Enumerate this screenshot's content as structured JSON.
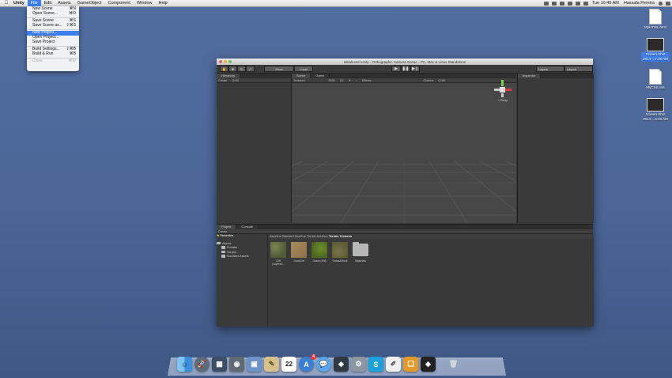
{
  "menubar": {
    "apple": "",
    "items": [
      "Unity",
      "File",
      "Edit",
      "Assets",
      "GameObject",
      "Component",
      "Window",
      "Help"
    ],
    "clock": "Tue 10:45 AM",
    "user": "Hassala Pereira"
  },
  "file_menu": {
    "new_scene": "New Scene",
    "new_scene_key": "⌘N",
    "open_scene": "Open Scene...",
    "open_scene_key": "⌘O",
    "save_scene": "Save Scene",
    "save_scene_key": "⌘S",
    "save_scene_as": "Save Scene as...",
    "save_scene_as_key": "⇧⌘S",
    "new_project": "New Project...",
    "open_project": "Open Project...",
    "save_project": "Save Project",
    "build_settings": "Build Settings...",
    "build_settings_key": "⇧⌘B",
    "build_run": "Build & Run",
    "build_run_key": "⌘B",
    "close": "Close",
    "close_key": "⌘W"
  },
  "desktop_icons": {
    "html_file": "MyHTML.html",
    "screenshot1_line1": "Screen Shot",
    "screenshot1_line2": "2014-...7.06 AM",
    "css_file": "MyCSS.css",
    "screenshot2_line1": "Screen Shot",
    "screenshot2_line2": "2014-...5.25 AM"
  },
  "unity": {
    "title": "initialLevel.unity - Orthographic Camera Scene - PC, Mac & Linux Standalone",
    "pivot": "Pivot",
    "local": "Local",
    "layers": "Layers",
    "layout": "Layout",
    "hierarchy_tab": "Hierarchy",
    "hierarchy_create": "Create",
    "hierarchy_search": "Q*All",
    "scene_tab": "Scene",
    "game_tab": "Game",
    "textured": "Textured",
    "rgb": "RGB",
    "twod": "2D",
    "effects": "Effects",
    "gizmos": "Gizmos",
    "scene_search": "Q*All",
    "persp": "< Persp",
    "inspector_tab": "Inspector",
    "project_tab": "Project",
    "console_tab": "Console",
    "project_create": "Create",
    "favorites": "Favorites",
    "tree": [
      "Assets",
      "Prefabs",
      "Scripts",
      "Standard Assets"
    ],
    "breadcrumb": [
      "Assets",
      "Standard Assets",
      "Terrain Assets",
      "Terrain Textures"
    ],
    "assets": [
      {
        "name": "Cliff (Layered...",
        "color": "#5e6a3e"
      },
      {
        "name": "GoodDirt",
        "color": "#9b7f55"
      },
      {
        "name": "Grass (Hill)",
        "color": "#5c7a25"
      },
      {
        "name": "Grass&Rock",
        "color": "#6d6a3d"
      },
      {
        "name": "Materials",
        "color": "#b7b7b7"
      }
    ]
  },
  "dock": {
    "icons": [
      "finder-icon",
      "launchpad-icon",
      "mission-control-icon",
      "image-capture-icon",
      "preview-icon",
      "notes-icon",
      "calendar-icon",
      "app-store-icon",
      "messages-icon",
      "photo-icon",
      "system-preferences-icon",
      "skype-icon",
      "textedit-icon",
      "photos-book-icon",
      "unity-icon",
      "trash-icon"
    ],
    "calendar_day": "22",
    "app_store_badge": "4"
  }
}
